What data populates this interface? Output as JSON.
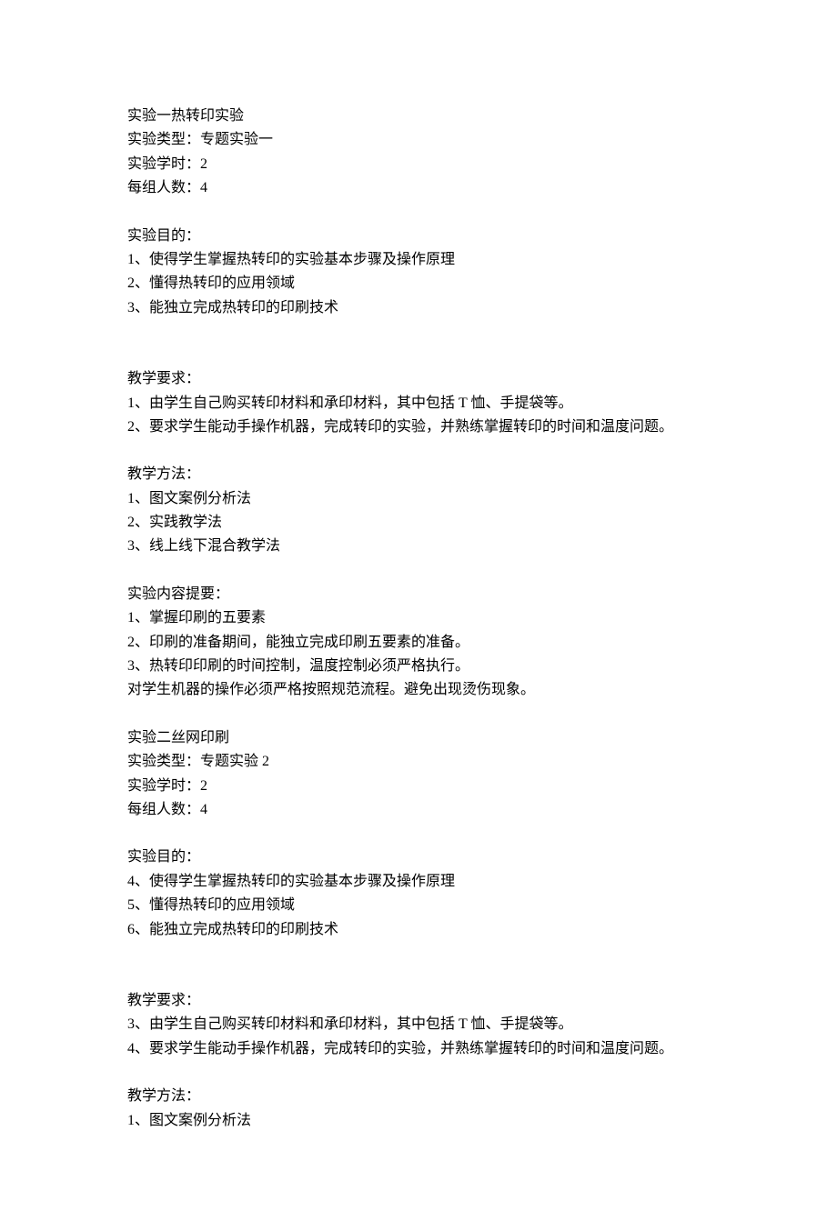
{
  "experiment1": {
    "header": [
      "实验一热转印实验",
      "实验类型：专题实验一",
      "实验学时：2",
      "每组人数：4"
    ],
    "purpose_title": "实验目的：",
    "purpose_items": [
      "1、使得学生掌握热转印的实验基本步骤及操作原理",
      "2、懂得热转印的应用领域",
      "3、能独立完成热转印的印刷技术"
    ],
    "requirements_title": "教学要求：",
    "requirements_items": [
      "1、由学生自己购买转印材料和承印材料，其中包括 T 恤、手提袋等。",
      "2、要求学生能动手操作机器，完成转印的实验，并熟练掌握转印的时间和温度问题。"
    ],
    "methods_title": "教学方法：",
    "methods_items": [
      "1、图文案例分析法",
      "2、实践教学法",
      "3、线上线下混合教学法"
    ],
    "content_title": "实验内容提要：",
    "content_items": [
      "1、掌握印刷的五要素",
      "2、印刷的准备期间，能独立完成印刷五要素的准备。",
      "3、热转印印刷的时间控制，温度控制必须严格执行。",
      "对学生机器的操作必须严格按照规范流程。避免出现烫伤现象。"
    ]
  },
  "experiment2": {
    "header": [
      "实验二丝网印刷",
      "实验类型：专题实验 2",
      "实验学时：2",
      "每组人数：4"
    ],
    "purpose_title": "实验目的：",
    "purpose_items": [
      "4、使得学生掌握热转印的实验基本步骤及操作原理",
      "5、懂得热转印的应用领域",
      "6、能独立完成热转印的印刷技术"
    ],
    "requirements_title": "教学要求：",
    "requirements_items": [
      "3、由学生自己购买转印材料和承印材料，其中包括 T 恤、手提袋等。",
      "4、要求学生能动手操作机器，完成转印的实验，并熟练掌握转印的时间和温度问题。"
    ],
    "methods_title": "教学方法：",
    "methods_items": [
      "1、图文案例分析法"
    ]
  }
}
